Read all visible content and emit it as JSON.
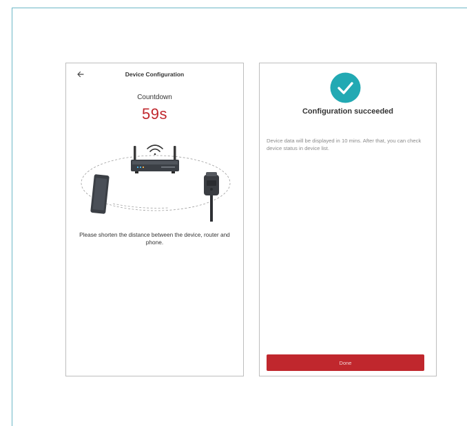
{
  "device_configuration_screen": {
    "title": "Device Configuration",
    "countdown_label": "Countdown",
    "countdown_value": "59s",
    "hint": "Please shorten the distance between the device, router and phone.",
    "icons": [
      "back-arrow-icon",
      "router-icon",
      "wifi-icon",
      "smartphone-icon",
      "device-icon"
    ]
  },
  "success_screen": {
    "title": "Configuration succeeded",
    "description": "Device data will be displayed in 10 mins. After that, you can check device status in device list.",
    "done_label": "Done",
    "icons": [
      "check-circle-icon"
    ]
  },
  "colors": {
    "accent_red": "#c0272d",
    "success_teal": "#22a9b3",
    "frame_line": "#6bb7c6"
  }
}
